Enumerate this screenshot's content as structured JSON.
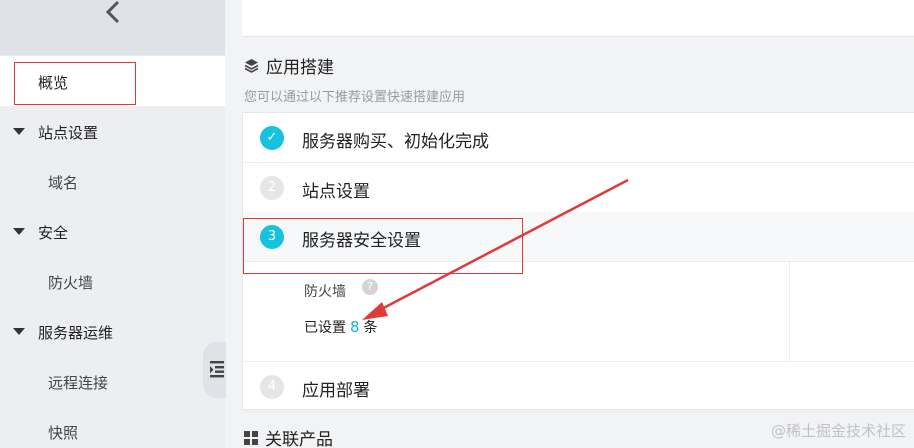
{
  "sidebar": {
    "items": [
      {
        "label": "概览",
        "active": true
      },
      {
        "label": "站点设置",
        "expandable": true
      },
      {
        "label": "域名"
      },
      {
        "label": "安全",
        "expandable": true
      },
      {
        "label": "防火墙"
      },
      {
        "label": "服务器运维",
        "expandable": true
      },
      {
        "label": "远程连接"
      },
      {
        "label": "快照"
      }
    ]
  },
  "main": {
    "section_title": "应用搭建",
    "section_desc": "您可以通过以下推荐设置快速搭建应用",
    "steps": [
      {
        "number": "✓",
        "title": "服务器购买、初始化完成",
        "status": "done"
      },
      {
        "number": "2",
        "title": "站点设置",
        "status": "todo"
      },
      {
        "number": "3",
        "title": "服务器安全设置",
        "status": "current"
      },
      {
        "number": "4",
        "title": "应用部署",
        "status": "todo"
      }
    ],
    "firewall": {
      "label": "防火墙",
      "help": "?",
      "prefix": "已设置",
      "count": "8",
      "suffix": "条"
    },
    "related_title": "关联产品"
  },
  "watermark": "@稀土掘金技术社区",
  "colors": {
    "accent": "#16c2dd",
    "annotation": "#e03b3b"
  }
}
